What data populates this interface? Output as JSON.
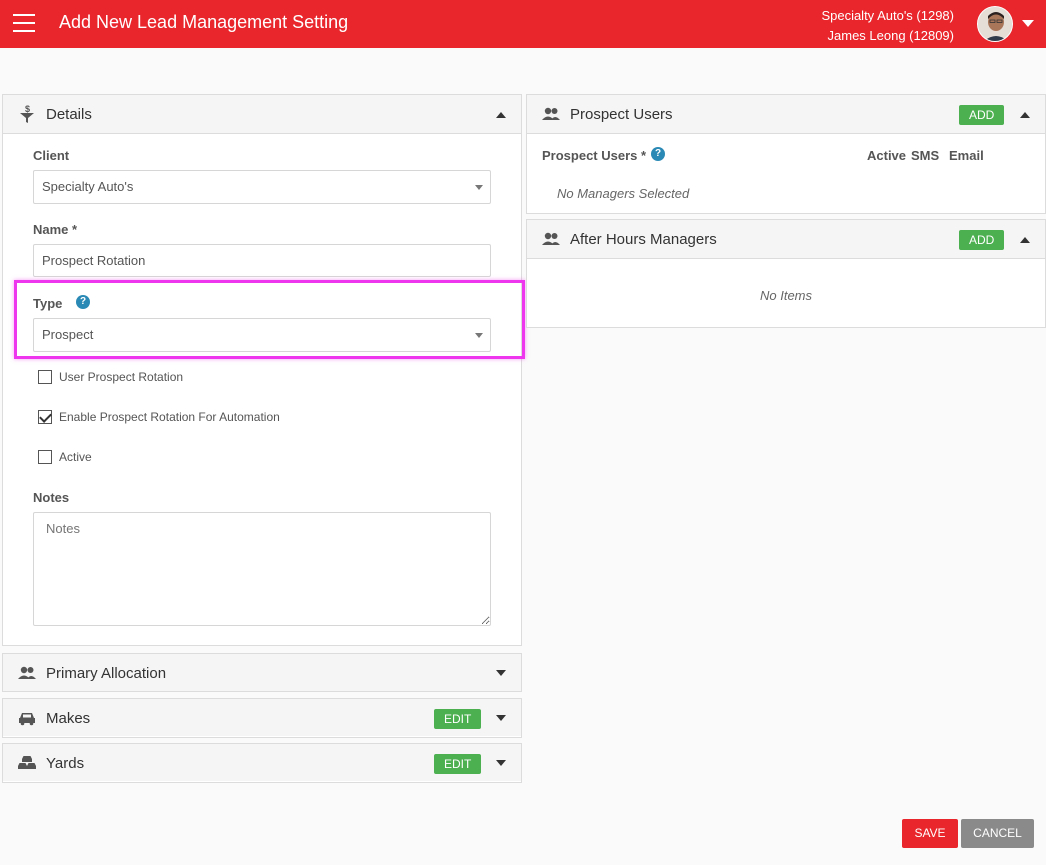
{
  "header": {
    "title": "Add New Lead Management Setting",
    "client_line": "Specialty Auto's (1298)",
    "user_line": "James Leong (12809)"
  },
  "details": {
    "title": "Details",
    "client_label": "Client",
    "client_value": "Specialty Auto's",
    "name_label": "Name *",
    "name_value": "Prospect Rotation",
    "type_label": "Type",
    "type_value": "Prospect",
    "checkboxes": [
      {
        "label": "User Prospect Rotation",
        "checked": false
      },
      {
        "label": "Enable Prospect Rotation For Automation",
        "checked": true
      },
      {
        "label": "Active",
        "checked": false
      }
    ],
    "notes_label": "Notes",
    "notes_placeholder": "Notes"
  },
  "primary_allocation": {
    "title": "Primary Allocation"
  },
  "makes": {
    "title": "Makes",
    "edit_label": "EDIT"
  },
  "yards": {
    "title": "Yards",
    "edit_label": "EDIT"
  },
  "prospect_users": {
    "title": "Prospect Users",
    "add_label": "ADD",
    "column_label": "Prospect Users *",
    "col_active": "Active",
    "col_sms": "SMS",
    "col_email": "Email",
    "empty_text": "No Managers Selected"
  },
  "after_hours": {
    "title": "After Hours Managers",
    "add_label": "ADD",
    "empty_text": "No Items"
  },
  "footer": {
    "save_label": "SAVE",
    "cancel_label": "CANCEL"
  },
  "help_glyph": "?",
  "colors": {
    "brand_red": "#e8262c",
    "add_green": "#4caf50",
    "help_blue": "#2a8ab5",
    "highlight": "#ef36ef"
  }
}
